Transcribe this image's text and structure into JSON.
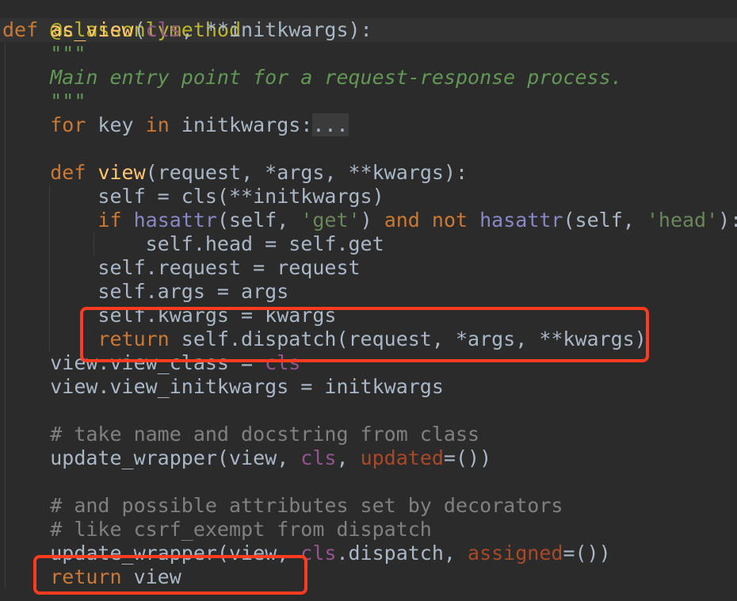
{
  "editor": {
    "language": "python",
    "colors": {
      "background": "#2b2b2b",
      "text": "#a9b7c6",
      "keyword": "#cc7832",
      "function_name": "#ffc66d",
      "cls_param": "#94558d",
      "decorator": "#bbb529",
      "docstring": "#629755",
      "string": "#6a8759",
      "comment": "#808080",
      "builtin": "#8888c6",
      "named_arg": "#aa4926",
      "annotation_box": "#ff3b1f"
    },
    "code": {
      "decorator": "@classonlymethod",
      "def": "def",
      "as_view_name": "as_view",
      "open_paren": "(",
      "cls": "cls",
      "as_view_params_rest": ", **initkwargs):",
      "doc_quotes_open": "\"\"\"",
      "doc_text": "Main entry point for a request-response process.",
      "doc_quotes_close": "\"\"\"",
      "for_kw": "for",
      "for_key": " key ",
      "in_kw": "in",
      "for_rest": " initkwargs:",
      "fold_marker": "...",
      "def2": "def",
      "view_name": "view",
      "view_params": "(request, *args, **kwargs):",
      "self_assign": "self = cls(**initkwargs)",
      "if_kw": "if",
      "hasattr1": "hasattr",
      "hasattr1_args_a": "(self, ",
      "str_get": "'get'",
      "hasattr1_args_b": ") ",
      "and_kw": "and",
      "not_kw": "not",
      "hasattr2": "hasattr",
      "hasattr2_args_a": "(self, ",
      "str_head": "'head'",
      "hasattr2_args_b": "):",
      "self_head": "self.head = self.get",
      "self_request": "self.request = request",
      "self_args": "self.args = args",
      "self_kwargs": "self.kwargs = kwargs",
      "return_kw": "return",
      "return_dispatch": " self.dispatch(request, *args, **kwargs)",
      "view_class_a": "view.view_class = ",
      "view_class_cls": "cls",
      "view_initkwargs": "view.view_initkwargs = initkwargs",
      "comment1": "# take name and docstring from class",
      "update1_a": "update_wrapper(view, ",
      "update1_cls": "cls",
      "update1_b": ", ",
      "update1_named": "updated",
      "update1_c": "=())",
      "comment2": "# and possible attributes set by decorators",
      "comment3": "# like csrf_exempt from dispatch",
      "update2_a": "update_wrapper(view, ",
      "update2_cls": "cls",
      "update2_b": ".dispatch, ",
      "update2_named": "assigned",
      "update2_c": "=())",
      "return_kw2": "return",
      "return_view": " view"
    }
  }
}
